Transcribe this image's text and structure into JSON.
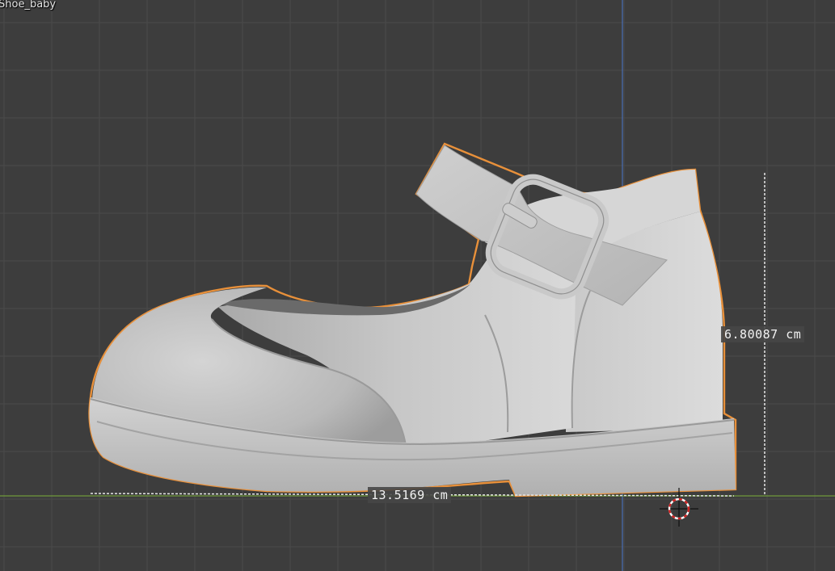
{
  "viewport": {
    "object_name": "Shoe_baby",
    "colors": {
      "background": "#3d3d3d",
      "grid_line": "#4a4a4a",
      "x_axis": "#6f9a3b",
      "z_axis": "#4a6fb5",
      "selection_outline": "#e8903a",
      "model_surface": "#c8c8c8"
    }
  },
  "measurements": {
    "height": "6.80087 cm",
    "width": "13.5169 cm"
  },
  "icons": {
    "cursor": "3d-cursor-icon"
  }
}
